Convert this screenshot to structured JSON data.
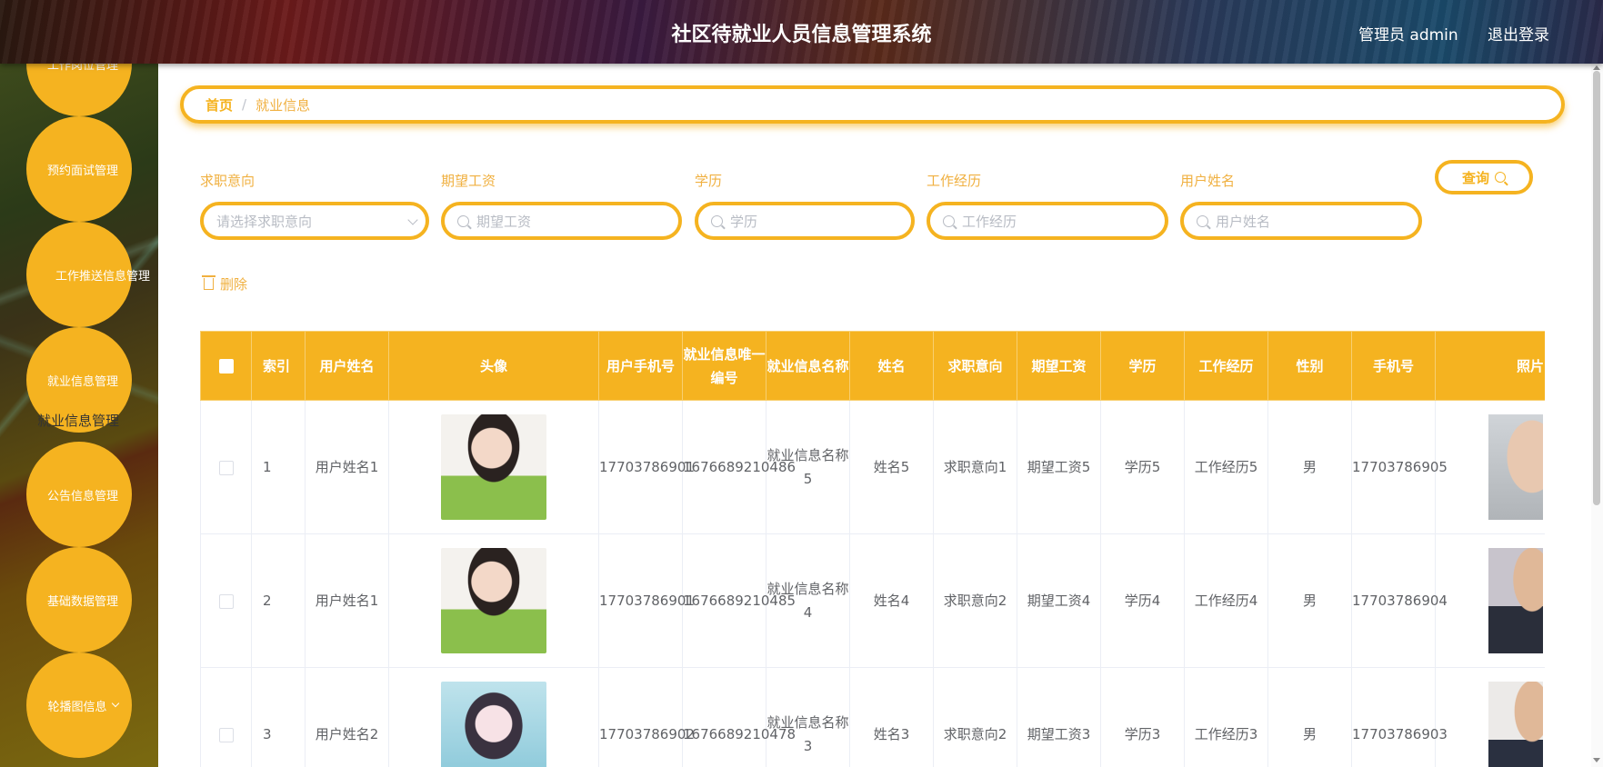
{
  "header": {
    "title": "社区待就业人员信息管理系统",
    "user": "管理员 admin",
    "logout": "退出登录"
  },
  "sidebar": {
    "items": [
      {
        "label": "工作岗位管理"
      },
      {
        "label": "预约面试管理"
      },
      {
        "label": "工作推送信息管理"
      },
      {
        "label": "就业信息管理"
      },
      {
        "label": "公告信息管理"
      },
      {
        "label": "基础数据管理"
      },
      {
        "label": "轮播图信息"
      }
    ],
    "tooltip": "就业信息管理"
  },
  "breadcrumb": {
    "home": "首页",
    "separator": "/",
    "current": "就业信息"
  },
  "filters": {
    "job_intent": {
      "label": "求职意向",
      "placeholder": "请选择求职意向"
    },
    "salary": {
      "label": "期望工资",
      "placeholder": "期望工资"
    },
    "education": {
      "label": "学历",
      "placeholder": "学历"
    },
    "experience": {
      "label": "工作经历",
      "placeholder": "工作经历"
    },
    "username": {
      "label": "用户姓名",
      "placeholder": "用户姓名"
    },
    "query_button": "查询"
  },
  "actions": {
    "delete": "删除"
  },
  "table": {
    "headers": [
      "索引",
      "用户姓名",
      "头像",
      "用户手机号",
      "就业信息唯一编号",
      "就业信息名称",
      "姓名",
      "求职意向",
      "期望工资",
      "学历",
      "工作经历",
      "性别",
      "手机号",
      "照片"
    ],
    "rows": [
      {
        "index": "1",
        "username": "用户姓名1",
        "avatar": "girl-photo",
        "user_phone": "17703786901",
        "code": "1676689210486",
        "info_name": "就业信息名称5",
        "name": "姓名5",
        "intent": "求职意向1",
        "salary": "期望工资5",
        "education": "学历5",
        "experience": "工作经历5",
        "gender": "男",
        "phone": "17703786905",
        "photo": "woman-photo"
      },
      {
        "index": "2",
        "username": "用户姓名1",
        "avatar": "girl-photo",
        "user_phone": "17703786901",
        "code": "1676689210485",
        "info_name": "就业信息名称4",
        "name": "姓名4",
        "intent": "求职意向2",
        "salary": "期望工资4",
        "education": "学历4",
        "experience": "工作经历4",
        "gender": "男",
        "phone": "17703786904",
        "photo": "man-photo"
      },
      {
        "index": "3",
        "username": "用户姓名2",
        "avatar": "anime-photo",
        "user_phone": "17703786902",
        "code": "1676689210478",
        "info_name": "就业信息名称3",
        "name": "姓名3",
        "intent": "求职意向2",
        "salary": "期望工资3",
        "education": "学历3",
        "experience": "工作经历3",
        "gender": "男",
        "phone": "17703786903",
        "photo": "man-photo"
      }
    ]
  },
  "colors": {
    "accent": "#f5b320",
    "accent_text": "#f0b040",
    "table_text": "#606266"
  }
}
